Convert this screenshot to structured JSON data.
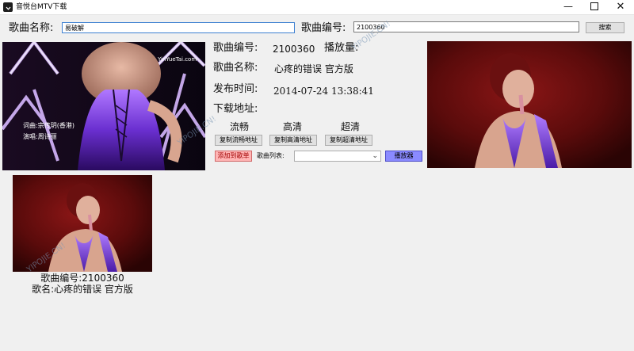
{
  "window": {
    "title": "音悦台MTV下载",
    "min_glyph": "—",
    "close_glyph": "✕"
  },
  "search": {
    "name_label": "歌曲名称:",
    "name_value": "易破解",
    "id_label": "歌曲编号:",
    "id_value": "2100360",
    "search_button": "搜索"
  },
  "info": {
    "id_label": "歌曲编号:",
    "id_value": "2100360",
    "plays_label": "播放量:",
    "name_label": "歌曲名称:",
    "name_value": "心疼的错误 官方版",
    "date_label": "发布时间:",
    "date_value": "2014-07-24 13:38:41",
    "download_label": "下载地址:"
  },
  "quality": {
    "smooth_label": "流畅",
    "hd_label": "高清",
    "super_label": "超清",
    "copy_smooth": "复制流畅地址",
    "copy_hd": "复制高清地址",
    "copy_super": "复制超清地址"
  },
  "actions": {
    "add_playlist": "添加到歌单",
    "playlist_label": "歌曲列表:",
    "player_button": "播放器"
  },
  "left_image": {
    "watermark": "YinYueTai.com",
    "lyric_credit": "词曲:宗传玥(香港)",
    "singer_credit": "演唱:周诗丽"
  },
  "results": [
    {
      "id_line": "歌曲编号:2100360",
      "name_line": "歌名:心疼的错误 官方版"
    }
  ],
  "watermarks": [
    "YIPOJIE.CN!",
    "YIPOJIE.CN!",
    "YIPOJIE.CN!"
  ]
}
